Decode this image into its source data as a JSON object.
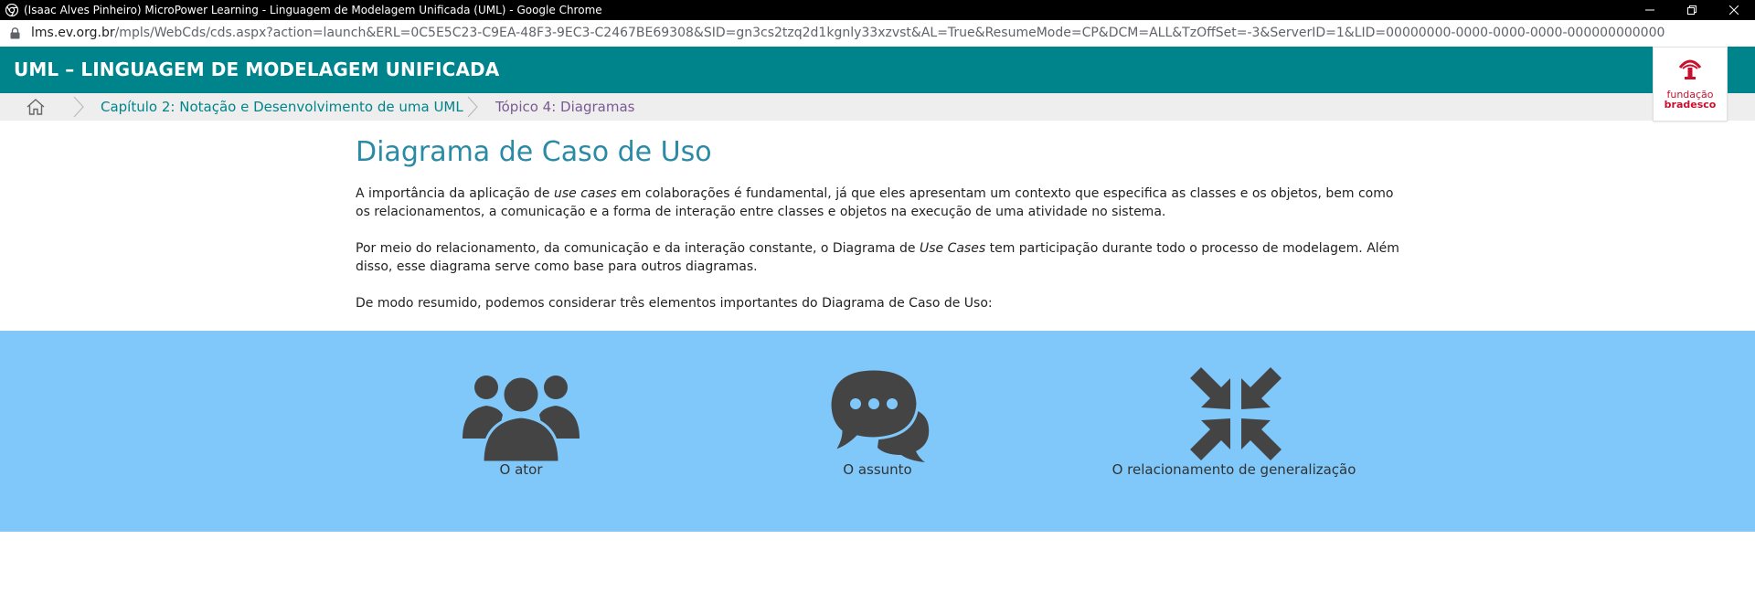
{
  "browser": {
    "window_title": "(Isaac Alves Pinheiro) MicroPower Learning - Linguagem de Modelagem Unificada (UML) - Google Chrome",
    "url_host": "lms.ev.org.br",
    "url_path": "/mpls/WebCds/cds.aspx?action=launch&ERL=0C5E5C23-C9EA-48F3-9EC3-C2467BE69308&SID=gn3cs2tzq2d1kgnly33xzvst&AL=True&ResumeMode=CP&DCM=ALL&TzOffSet=-3&ServerID=1&LID=00000000-0000-0000-0000-000000000000",
    "controls": {
      "minimize": "minimize-icon",
      "restore": "restore-icon",
      "close": "close-icon"
    }
  },
  "header": {
    "course_title": "UML – LINGUAGEM DE MODELAGEM UNIFICADA",
    "accent_color": "#00848b"
  },
  "logo": {
    "line1": "fundação",
    "line2": "bradesco",
    "color": "#c8102e"
  },
  "breadcrumb": {
    "home_icon": "home-icon",
    "items": [
      {
        "label": "Capítulo 2: Notação e Desenvolvimento de uma UML"
      },
      {
        "label": "Tópico 4: Diagramas"
      }
    ]
  },
  "content": {
    "title": "Diagrama de Caso de Uso",
    "p1_before": "A importância da aplicação de ",
    "p1_em": "use cases",
    "p1_after": " em colaborações é fundamental, já que eles apresentam um contexto que especifica as classes e os objetos, bem como os relacionamentos, a comunicação e a forma de interação entre classes e objetos na execução de uma atividade no sistema.",
    "p2_before": "Por meio do relacionamento, da comunicação e da interação constante, o Diagrama de ",
    "p2_em": "Use Cases",
    "p2_after": " tem participação durante todo o processo de modelagem. Além disso, esse diagrama serve como base para outros diagramas.",
    "p3": "De modo resumido, podemos considerar três elementos importantes do Diagrama de Caso de Uso:"
  },
  "elements": {
    "band_color": "#80c8fa",
    "items": [
      {
        "label": "O ator",
        "icon": "users-icon"
      },
      {
        "label": "O assunto",
        "icon": "chat-bubbles-icon"
      },
      {
        "label": "O relacionamento de generalização",
        "icon": "compress-arrows-icon"
      }
    ]
  }
}
